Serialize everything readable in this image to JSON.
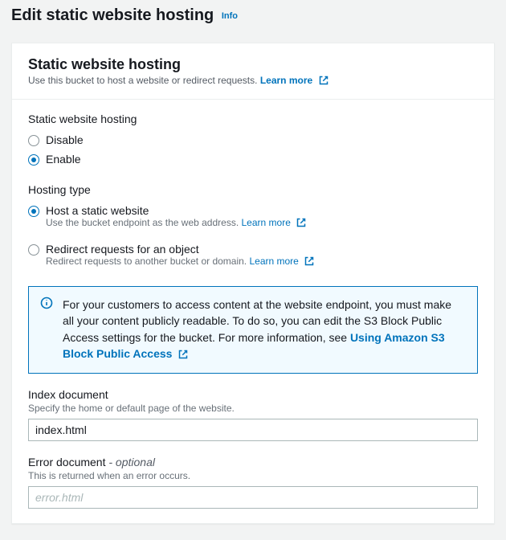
{
  "page": {
    "title": "Edit static website hosting",
    "info_label": "Info"
  },
  "panel": {
    "title": "Static website hosting",
    "subtitle": "Use this bucket to host a website or redirect requests.",
    "learn_more": "Learn more"
  },
  "hosting_toggle": {
    "label": "Static website hosting",
    "options": {
      "disable": "Disable",
      "enable": "Enable"
    },
    "selected": "enable"
  },
  "hosting_type": {
    "label": "Hosting type",
    "options": {
      "static": {
        "label": "Host a static website",
        "sub": "Use the bucket endpoint as the web address.",
        "learn_more": "Learn more"
      },
      "redirect": {
        "label": "Redirect requests for an object",
        "sub": "Redirect requests to another bucket or domain.",
        "learn_more": "Learn more"
      }
    },
    "selected": "static"
  },
  "alert": {
    "text": "For your customers to access content at the website endpoint, you must make all your content publicly readable. To do so, you can edit the S3 Block Public Access settings for the bucket. For more information, see ",
    "link_text": "Using Amazon S3 Block Public Access"
  },
  "index_doc": {
    "label": "Index document",
    "hint": "Specify the home or default page of the website.",
    "value": "index.html"
  },
  "error_doc": {
    "label": "Error document",
    "optional_suffix": "- optional",
    "hint": "This is returned when an error occurs.",
    "placeholder": "error.html",
    "value": ""
  }
}
